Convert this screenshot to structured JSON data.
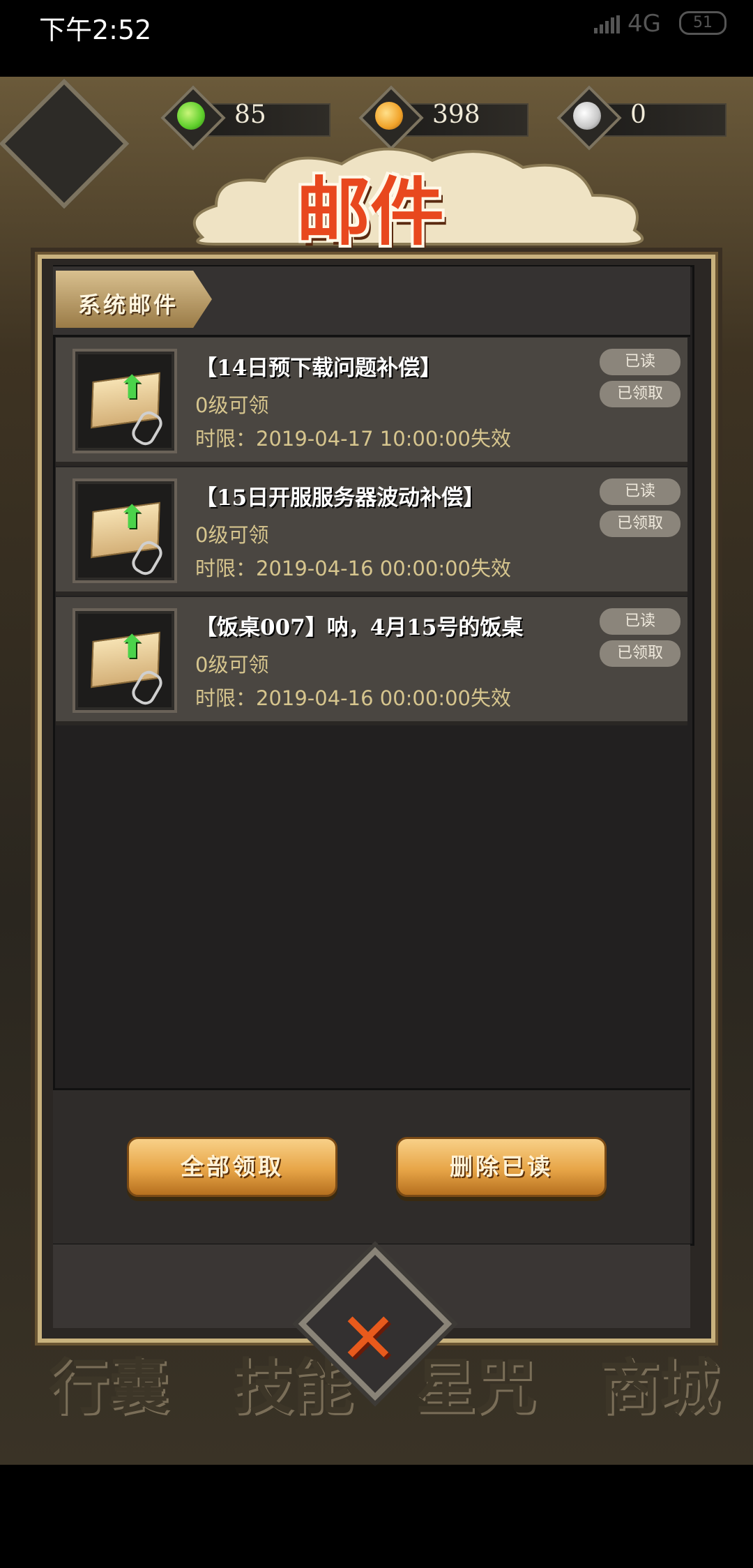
{
  "status_bar": {
    "time": "下午2:52",
    "network": "4G",
    "battery": "51"
  },
  "currency": [
    {
      "name": "green-jade",
      "value": "85",
      "color": "#5fcf2c"
    },
    {
      "name": "gold-coin",
      "value": "398",
      "color": "#f1a32a"
    },
    {
      "name": "silver-coin",
      "value": "0",
      "color": "#c7c7c7"
    }
  ],
  "title": "邮件",
  "tab": {
    "label": "系统邮件"
  },
  "mails": [
    {
      "title": "【14日预下载问题补偿】",
      "level": "0级可领",
      "expire": "时限：2019-04-17 10:00:00失效",
      "read_label": "已读",
      "claimed_label": "已领取"
    },
    {
      "title": "【15日开服服务器波动补偿】",
      "level": "0级可领",
      "expire": "时限：2019-04-16 00:00:00失效",
      "read_label": "已读",
      "claimed_label": "已领取"
    },
    {
      "title": "【饭桌007】呐，4月15号的饭桌",
      "level": "0级可领",
      "expire": "时限：2019-04-16 00:00:00失效",
      "read_label": "已读",
      "claimed_label": "已领取"
    }
  ],
  "buttons": {
    "claim_all": "全部领取",
    "delete_read": "删除已读"
  },
  "nav": [
    "行囊",
    "技能",
    "星咒",
    "商城"
  ]
}
